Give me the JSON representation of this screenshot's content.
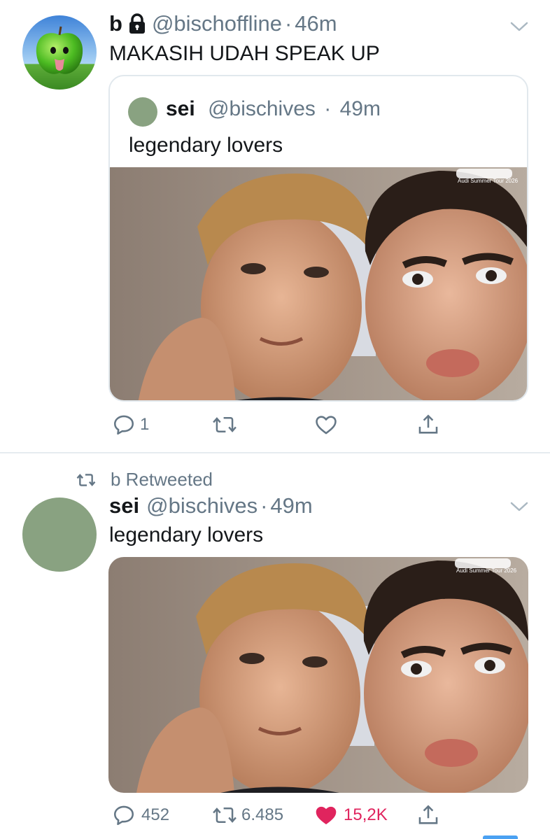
{
  "tweet1": {
    "display_name": "b",
    "handle": "@bischoffline",
    "separator": "·",
    "time": "46m",
    "text": "MAKASIH UDAH SPEAK UP",
    "quote": {
      "display_name": "sei",
      "handle": "@bischives",
      "separator": "·",
      "time": "49m",
      "text": "legendary lovers",
      "media_caption": "Audi Summer Tour 2026"
    },
    "actions": {
      "reply_count": "1",
      "retweet_count": "",
      "like_count": ""
    }
  },
  "tweet2": {
    "retweet_context": "b Retweeted",
    "display_name": "sei",
    "handle": "@bischives",
    "separator": "·",
    "time": "49m",
    "text": "legendary lovers",
    "media_caption": "Audi Summer Tour 2026",
    "actions": {
      "reply_count": "452",
      "retweet_count": "6.485",
      "like_count": "15,2K",
      "liked": true
    }
  },
  "colors": {
    "text": "#14171a",
    "secondary": "#657786",
    "like_red": "#e0245e",
    "divider": "#e6ecf0",
    "avatar_sage": "#89a281"
  },
  "icons": [
    "lock-icon",
    "chevron-down-icon",
    "reply-icon",
    "retweet-icon",
    "like-icon",
    "share-icon"
  ]
}
